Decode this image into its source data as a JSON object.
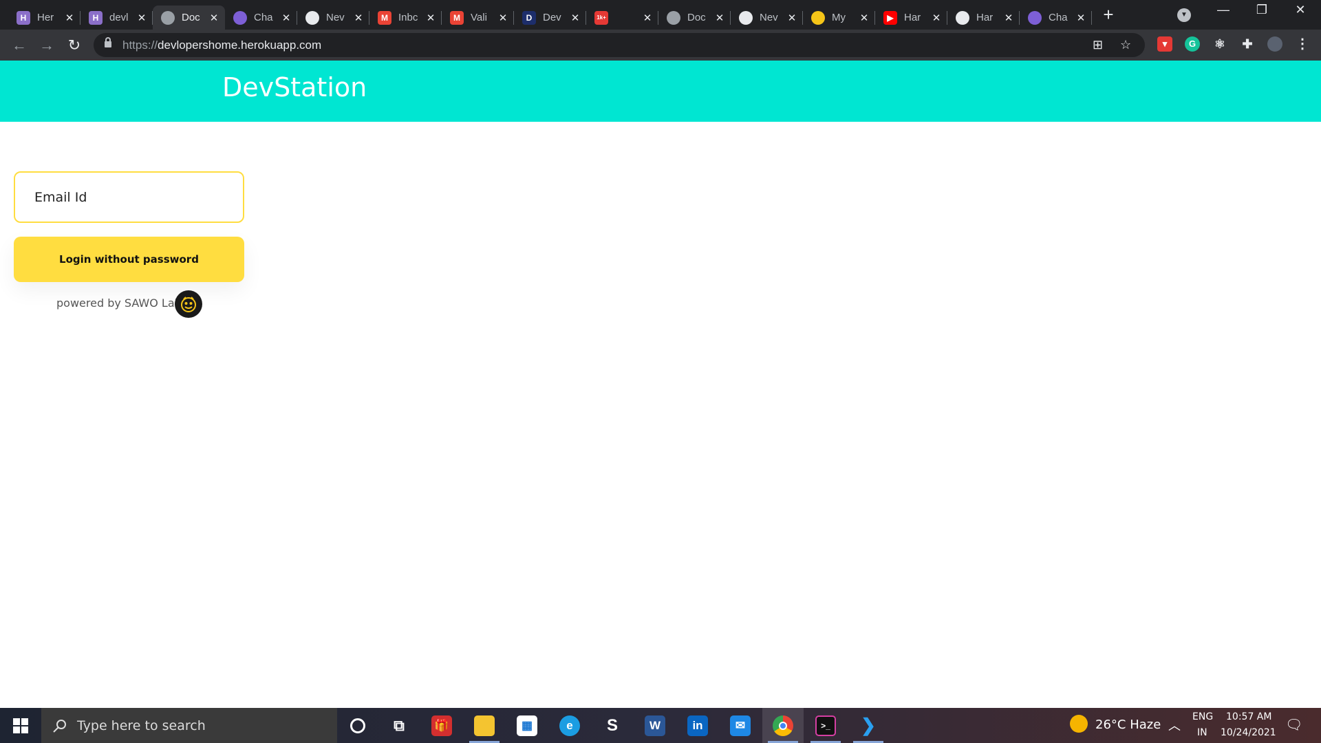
{
  "browser": {
    "tabs": [
      {
        "title": "Her",
        "icon": "heroku-icon",
        "color": "#8b6fc9",
        "glyph": "H"
      },
      {
        "title": "devl",
        "icon": "heroku-icon",
        "color": "#8b6fc9",
        "glyph": "H"
      },
      {
        "title": "Doc",
        "icon": "globe-icon",
        "color": "#9aa0a6",
        "glyph": "",
        "active": true
      },
      {
        "title": "Cha",
        "icon": "purple-circle-icon",
        "color": "#7d5fd6",
        "glyph": ""
      },
      {
        "title": "Nev",
        "icon": "chrome-icon",
        "color": "#e8eaed",
        "glyph": ""
      },
      {
        "title": "Inbc",
        "icon": "gmail-icon",
        "color": "#ea4335",
        "glyph": "M"
      },
      {
        "title": "Vali",
        "icon": "gmail-icon",
        "color": "#ea4335",
        "glyph": "M"
      },
      {
        "title": "Dev",
        "icon": "dev-icon",
        "color": "#1d2e6b",
        "glyph": "D"
      },
      {
        "title": "",
        "icon": "notification-icon",
        "color": "#e53935",
        "glyph": "1k+"
      },
      {
        "title": "Doc",
        "icon": "globe-icon",
        "color": "#9aa0a6",
        "glyph": ""
      },
      {
        "title": "Nev",
        "icon": "chrome-icon",
        "color": "#e8eaed",
        "glyph": ""
      },
      {
        "title": "My",
        "icon": "sawo-icon",
        "color": "#f5c518",
        "glyph": ""
      },
      {
        "title": "Har",
        "icon": "youtube-icon",
        "color": "#ff0000",
        "glyph": "▶"
      },
      {
        "title": "Har",
        "icon": "github-icon",
        "color": "#e8eaed",
        "glyph": ""
      },
      {
        "title": "Cha",
        "icon": "purple-circle-icon",
        "color": "#7d5fd6",
        "glyph": ""
      }
    ],
    "close_glyph": "✕",
    "new_tab_glyph": "+",
    "url_scheme": "https://",
    "url_host": "devlopershome.herokuapp.com"
  },
  "page": {
    "brand": "DevStation",
    "email_placeholder": "Email Id",
    "login_button": "Login without password",
    "powered_by": "powered by SAWO Labs"
  },
  "taskbar": {
    "search_placeholder": "Type here to search",
    "weather": "26°C  Haze",
    "lang_top": "ENG",
    "lang_bottom": "IN",
    "time": "10:57 AM",
    "date": "10/24/2021"
  },
  "colors": {
    "header": "#00e6d2",
    "accent": "#ffdd40"
  }
}
